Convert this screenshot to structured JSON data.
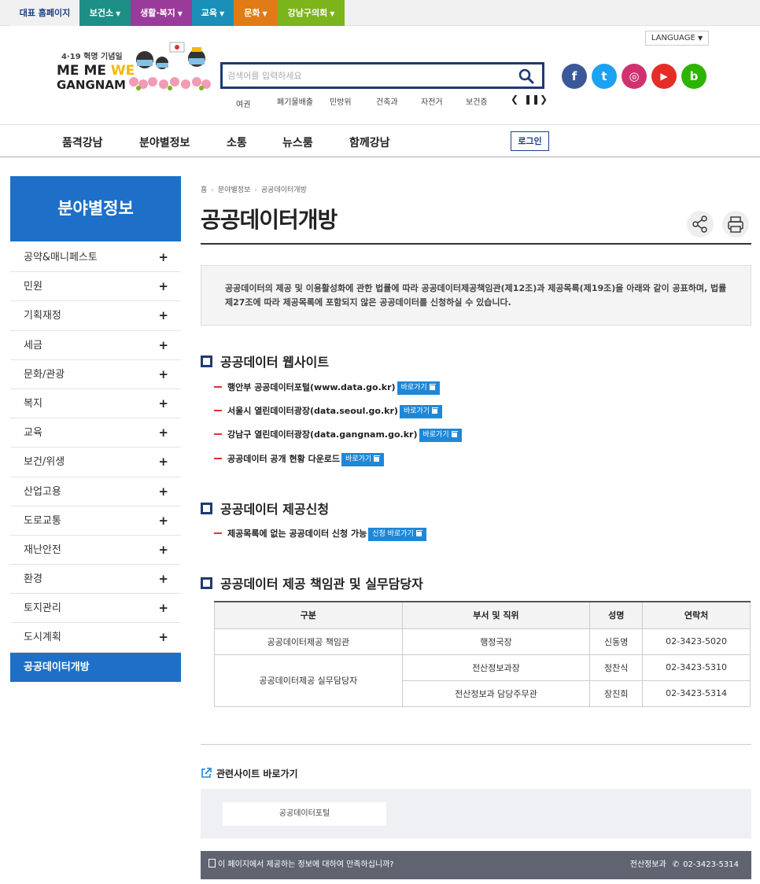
{
  "topbar": {
    "tabs": [
      {
        "label": "대표 홈페이지",
        "color": "#f1f1f1",
        "text_color": "#1a3f86"
      },
      {
        "label": "보건소",
        "color": "#1d8f86"
      },
      {
        "label": "생활·복지",
        "color": "#9a3b9c"
      },
      {
        "label": "교육",
        "color": "#1a8fb8"
      },
      {
        "label": "문화",
        "color": "#e07b16"
      },
      {
        "label": "강남구의회",
        "color": "#7cb41c"
      }
    ]
  },
  "header": {
    "language_label": "LANGUAGE",
    "logo": {
      "tagline": "4·19 혁명 기념일",
      "line1a": "ME ME ",
      "line1b": "WE",
      "line2": "GANGNAM"
    },
    "search_placeholder": "검색어를 입력하세요",
    "keywords": [
      "여권",
      "폐기물배출",
      "민방위",
      "건축과",
      "자전거",
      "보건증"
    ],
    "social": [
      {
        "name": "facebook",
        "glyph": "f",
        "color": "#3b5998"
      },
      {
        "name": "twitter",
        "glyph": "t",
        "color": "#1da1f2"
      },
      {
        "name": "instagram",
        "glyph": "◎",
        "color": "#d1316e"
      },
      {
        "name": "youtube",
        "glyph": "▶",
        "color": "#e52d27"
      },
      {
        "name": "blog",
        "glyph": "b",
        "color": "#2db400"
      }
    ]
  },
  "gnb": {
    "items": [
      "품격강남",
      "분야별정보",
      "소통",
      "뉴스룸",
      "함께강남"
    ],
    "login": "로그인"
  },
  "lnb": {
    "title": "분야별정보",
    "items": [
      "공약&매니페스토",
      "민원",
      "기획재정",
      "세금",
      "문화/관광",
      "복지",
      "교육",
      "보건/위생",
      "산업고용",
      "도로교통",
      "재난안전",
      "환경",
      "토지관리",
      "도시계획"
    ],
    "active": "공공데이터개방"
  },
  "breadcrumb": [
    "홈",
    "분야별정보",
    "공공데이터개방"
  ],
  "page_title": "공공데이터개방",
  "intro": "공공데이터의 제공 및 이용활성화에 관한 법률에 따라 공공데이터제공책임관(제12조)과 제공목록(제19조)을 아래와 같이 공표하며, 법률 제27조에 따라 제공목록에 포함되지 않은 공공데이터를 신청하실 수 있습니다.",
  "sections": {
    "websites": {
      "title": "공공데이터 웹사이트",
      "items": [
        {
          "label": "행안부 공공데이터포털(www.data.go.kr)",
          "button": "바로가기"
        },
        {
          "label": "서울시 열린데이터광장(data.seoul.go.kr)",
          "button": "바로가기"
        },
        {
          "label": "강남구 열린데이터광장(data.gangnam.go.kr)",
          "button": "바로가기"
        },
        {
          "label": "공공데이터 공개 현황 다운로드",
          "button": "바로가기"
        }
      ]
    },
    "request": {
      "title": "공공데이터 제공신청",
      "items": [
        {
          "label": "제공목록에 없는 공공데이터 신청 가능",
          "button": "신청 바로가기"
        }
      ]
    },
    "officers": {
      "title": "공공데이터 제공 책임관 및 실무담당자",
      "headers": [
        "구분",
        "부서 및 직위",
        "성명",
        "연락처"
      ],
      "rows": [
        {
          "category": "공공데이터제공 책임관",
          "dept": "행정국장",
          "name": "신동명",
          "phone": "02-3423-5020"
        },
        {
          "category": "공공데이터제공 실무담당자",
          "dept": "전산정보과장",
          "name": "정찬식",
          "phone": "02-3423-5310"
        },
        {
          "category": "",
          "dept": "전산정보과 담당주무관",
          "name": "장진희",
          "phone": "02-3423-5314"
        }
      ]
    }
  },
  "related": {
    "title": "관련사이트 바로가기",
    "button": "공공데이터포털"
  },
  "footer": {
    "question": "이 페이지에서 제공하는 정보에 대하여 만족하십니까?",
    "dept": "전산정보과",
    "phone": "02-3423-5314"
  }
}
